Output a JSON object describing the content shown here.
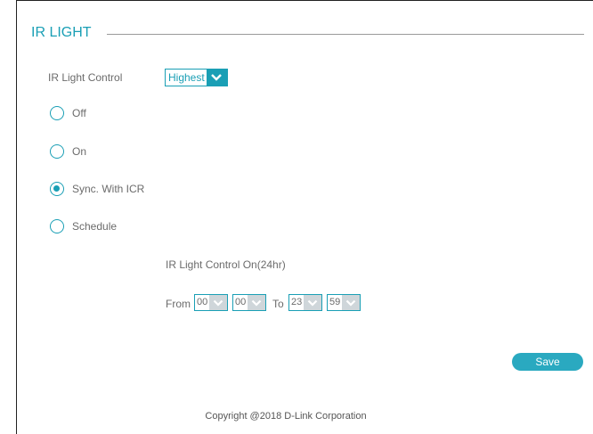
{
  "section": {
    "title": "IR LIGHT"
  },
  "ir_control": {
    "label": "IR Light Control",
    "selected": "Highest"
  },
  "modes": [
    {
      "label": "Off",
      "checked": false
    },
    {
      "label": "On",
      "checked": false
    },
    {
      "label": "Sync. With ICR",
      "checked": true
    },
    {
      "label": "Schedule",
      "checked": false
    }
  ],
  "schedule": {
    "heading": "IR Light Control On(24hr)",
    "from_label": "From",
    "from_hour": "00",
    "from_minute": "00",
    "to_label": "To",
    "to_hour": "23",
    "to_minute": "59"
  },
  "actions": {
    "save_label": "Save"
  },
  "footer": {
    "copyright": "Copyright @2018 D-Link Corporation"
  },
  "colors": {
    "accent": "#1a9fb5",
    "button": "#2aa9c0",
    "text": "#6b6b6b"
  },
  "icons": {
    "dropdown": "chevron-down-icon"
  }
}
